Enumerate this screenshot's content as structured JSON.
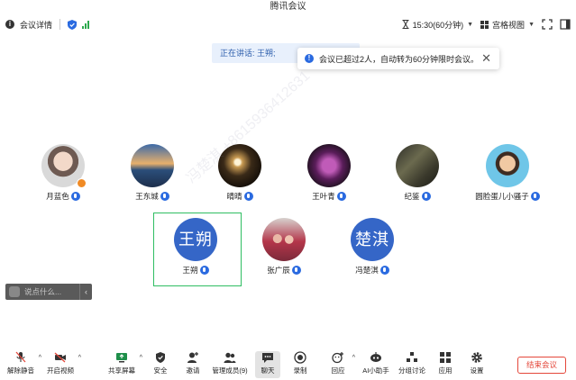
{
  "window": {
    "title": "腾讯会议"
  },
  "topbar": {
    "meeting_details": "会议详情",
    "timer": "15:30(60分钟)",
    "view": "宫格视图"
  },
  "speaking": {
    "label": "正在讲话: 王朔;"
  },
  "toast": {
    "message": "会议已超过2人，自动转为60分钟限时会议。"
  },
  "participants": [
    {
      "name": "月蓝色"
    },
    {
      "name": "王东城"
    },
    {
      "name": "晴晴"
    },
    {
      "name": "王叶青"
    },
    {
      "name": "纪鉴"
    },
    {
      "name": "圆脸蛋儿小骚子"
    },
    {
      "name": "王朔",
      "avatar_text": "王朔"
    },
    {
      "name": "张广辰"
    },
    {
      "name": "冯楚淇",
      "avatar_text": "楚淇"
    }
  ],
  "chat": {
    "placeholder": "说点什么..."
  },
  "toolbar": {
    "unmute": "解除静音",
    "start_video": "开启视频",
    "share": "共享屏幕",
    "security": "安全",
    "invite": "邀请",
    "members": "管理成员(9)",
    "chat": "聊天",
    "record": "录制",
    "react": "回应",
    "ai": "AI小助手",
    "breakout": "分组讨论",
    "apps": "应用",
    "settings": "设置",
    "end": "结束会议"
  },
  "watermark": "冯楚淇 +8615936412631",
  "colors": {
    "accent": "#2a6ae0",
    "avatar_blue": "#3566c7",
    "end_red": "#e4473a",
    "selected_green": "#2fbe62"
  }
}
